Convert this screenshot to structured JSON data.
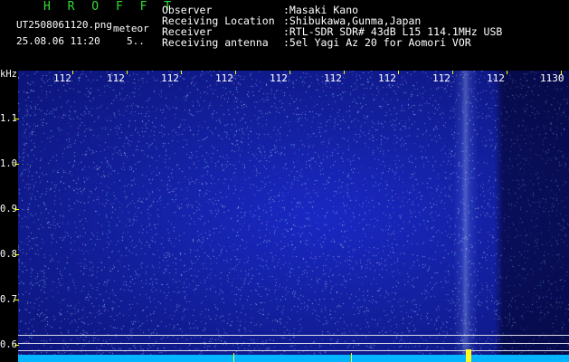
{
  "app_name": "H R O F F T",
  "filename": "UT2508061120.png",
  "mode": "meteor",
  "timestamp": "25.08.06 11:20",
  "duration": "5..",
  "info": [
    {
      "label": "Observer",
      "value": ":Masaki Kano"
    },
    {
      "label": "Receiving Location",
      "value": ":Shibukawa,Gunma,Japan"
    },
    {
      "label": "Receiver",
      "value": ":RTL-SDR SDR# 43dB L15 114.1MHz USB"
    },
    {
      "label": "Receiving antenna",
      "value": ":5el Yagi Az 20 for Aomori VOR"
    }
  ],
  "y_unit": "kHz",
  "y_ticks": [
    "1.1",
    "1.0",
    "0.9",
    "0.8",
    "0.7",
    "0.6"
  ],
  "x_ticks": [
    "112",
    "112",
    "112",
    "112",
    "112",
    "112",
    "112",
    "112",
    "112",
    "1130"
  ],
  "colors": {
    "title_green": "#33dd33",
    "label_white": "#ffffff",
    "value_cyan": "#66ddff",
    "tick_yellow": "#ffff00",
    "spectrum_blue": "#1a26b8",
    "baseline_cyan": "#00b4ff"
  }
}
